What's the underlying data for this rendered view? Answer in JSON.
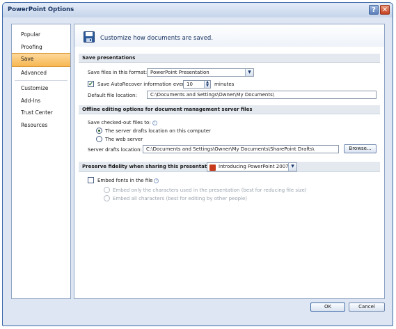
{
  "window": {
    "title": "PowerPoint Options",
    "help_glyph": "?",
    "close_glyph": "✕"
  },
  "nav": {
    "items": [
      {
        "label": "Popular"
      },
      {
        "label": "Proofing"
      },
      {
        "label": "Save",
        "active": true
      },
      {
        "label": "Advanced"
      },
      {
        "label": "Customize"
      },
      {
        "label": "Add-Ins"
      },
      {
        "label": "Trust Center"
      },
      {
        "label": "Resources"
      }
    ]
  },
  "header": {
    "text": "Customize how documents are saved.",
    "icon": "save-disk-icon"
  },
  "save_presentations": {
    "heading": "Save presentations",
    "format_label": "Save files in this format:",
    "format_value": "PowerPoint Presentation",
    "autorecover_label": "Save AutoRecover information every",
    "autorecover_checked": true,
    "autorecover_value": "10",
    "minutes_label": "minutes",
    "default_location_label": "Default file location:",
    "default_location_value": "C:\\Documents and Settings\\Owner\\My Documents\\"
  },
  "offline": {
    "heading": "Offline editing options for document management server files",
    "checkout_label": "Save checked-out files to:",
    "option_drafts": "The server drafts location on this computer",
    "option_web": "The web server",
    "selected": "drafts",
    "drafts_location_label": "Server drafts location:",
    "drafts_location_value": "C:\\Documents and Settings\\Owner\\My Documents\\SharePoint Drafts\\",
    "browse_label": "Browse..."
  },
  "fidelity": {
    "heading": "Preserve fidelity when sharing this presentation:",
    "presentation_value": "Introducing PowerPoint 2007",
    "embed_label": "Embed fonts in the file",
    "embed_checked": false,
    "embed_only_used": "Embed only the characters used in the presentation (best for reducing file size)",
    "embed_all": "Embed all characters (best for editing by other people)"
  },
  "footer": {
    "ok_label": "OK",
    "cancel_label": "Cancel"
  },
  "colors": {
    "accent": "#3b68a6",
    "active_nav": "#f7b752",
    "window_bg": "#dde6f2"
  }
}
